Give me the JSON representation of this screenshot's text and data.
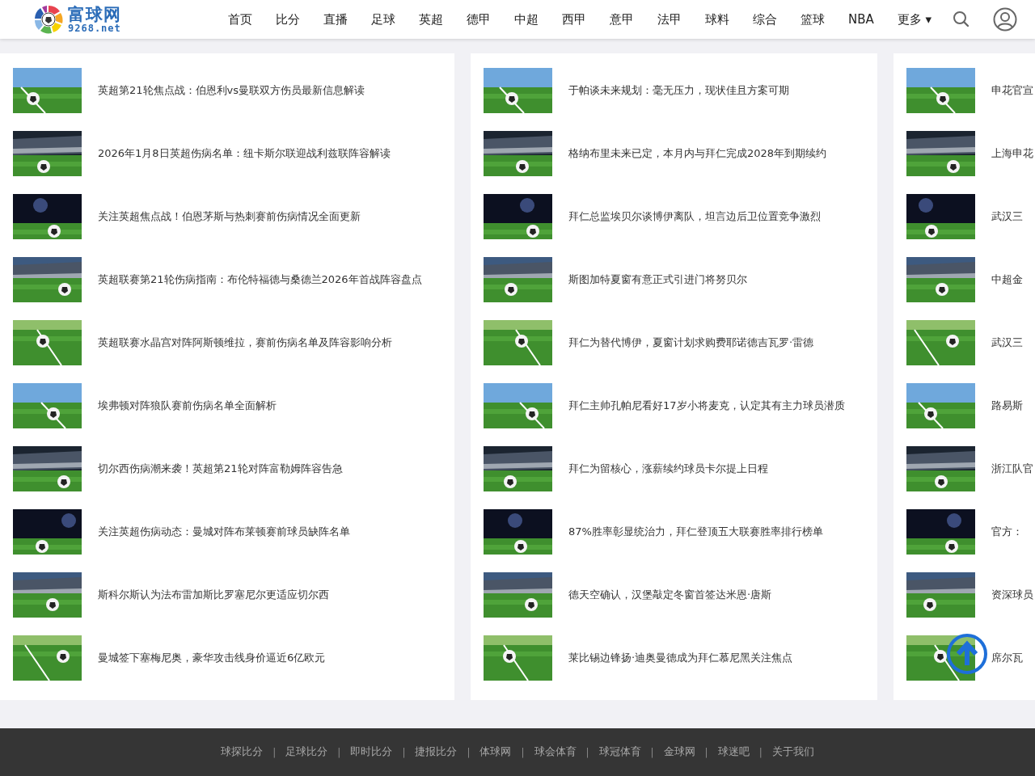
{
  "header": {
    "logo": {
      "name": "富球网",
      "domain": "9268.net"
    },
    "nav": [
      "首页",
      "比分",
      "直播",
      "足球",
      "英超",
      "德甲",
      "中超",
      "西甲",
      "意甲",
      "法甲",
      "球料",
      "综合",
      "篮球",
      "NBA"
    ],
    "more": {
      "label": "更多",
      "caret": "▾"
    }
  },
  "columns": [
    {
      "items": [
        {
          "title": "英超第21轮焦点战：伯恩利vs曼联双方伤员最新信息解读"
        },
        {
          "title": "2026年1月8日英超伤病名单：纽卡斯尔联迎战利兹联阵容解读"
        },
        {
          "title": "关注英超焦点战！伯恩茅斯与热刺赛前伤病情况全面更新"
        },
        {
          "title": "英超联赛第21轮伤病指南：布伦特福德与桑德兰2026年首战阵容盘点"
        },
        {
          "title": "英超联赛水晶宫对阵阿斯顿维拉，赛前伤病名单及阵容影响分析"
        },
        {
          "title": "埃弗顿对阵狼队赛前伤病名单全面解析"
        },
        {
          "title": "切尔西伤病潮来袭！英超第21轮对阵富勒姆阵容告急"
        },
        {
          "title": "关注英超伤病动态：曼城对阵布莱顿赛前球员缺阵名单"
        },
        {
          "title": "斯科尔斯认为法布雷加斯比罗塞尼尔更适应切尔西"
        },
        {
          "title": "曼城签下塞梅尼奥，豪华攻击线身价逼近6亿欧元"
        }
      ]
    },
    {
      "items": [
        {
          "title": "于帕谈未来规划：毫无压力，现状佳且方案可期"
        },
        {
          "title": "格纳布里未来已定，本月内与拜仁完成2028年到期续约"
        },
        {
          "title": "拜仁总监埃贝尔谈博伊离队，坦言边后卫位置竞争激烈"
        },
        {
          "title": "斯图加特夏窗有意正式引进门将努贝尔"
        },
        {
          "title": "拜仁为替代博伊，夏窗计划求购费耶诺德吉瓦罗·雷德"
        },
        {
          "title": "拜仁主帅孔帕尼看好17岁小将麦克，认定其有主力球员潜质"
        },
        {
          "title": "拜仁为留核心，涨薪续约球员卡尔提上日程"
        },
        {
          "title": "87%胜率彰显统治力，拜仁登顶五大联赛胜率排行榜单"
        },
        {
          "title": "德天空确认，汉堡敲定冬窗首签达米恩·唐斯"
        },
        {
          "title": "莱比锡边锋扬·迪奥曼德成为拜仁慕尼黑关注焦点"
        }
      ]
    },
    {
      "items": [
        {
          "title": "申花官宣"
        },
        {
          "title": "上海申花"
        },
        {
          "title": "武汉三"
        },
        {
          "title": "中超金"
        },
        {
          "title": "武汉三"
        },
        {
          "title": "路易斯"
        },
        {
          "title": "浙江队官"
        },
        {
          "title": "官方："
        },
        {
          "title": "资深球员"
        },
        {
          "title": "席尔瓦"
        }
      ]
    }
  ],
  "footer": {
    "links": [
      "球探比分",
      "足球比分",
      "即时比分",
      "捷报比分",
      "体球网",
      "球会体育",
      "球冠体育",
      "金球网",
      "球迷吧",
      "关于我们"
    ],
    "separator": "|"
  }
}
